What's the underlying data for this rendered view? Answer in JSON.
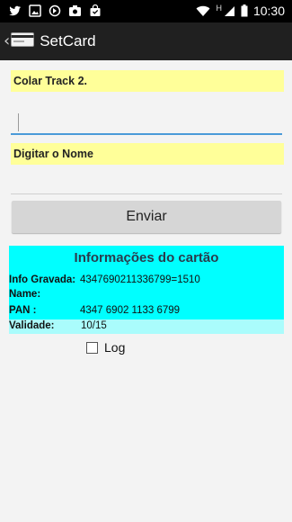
{
  "status_bar": {
    "time": "10:30",
    "left_icons": [
      "twitter-icon",
      "image-icon",
      "sync-icon",
      "camera-icon",
      "shopping-bag-icon"
    ],
    "right_icons": [
      "wifi-icon",
      "signal-icon",
      "battery-icon"
    ],
    "network_type": "H"
  },
  "action_bar": {
    "title": "SetCard"
  },
  "form": {
    "track_label": "Colar Track 2.",
    "track_value": "",
    "name_label": "Digitar o Nome",
    "name_value": "",
    "send_label": "Enviar"
  },
  "card_info": {
    "title": "Informações do cartão",
    "rows": [
      {
        "key": "Info Gravada:",
        "value": "4347690211336799=1510"
      },
      {
        "key": "Name:",
        "value": ""
      },
      {
        "key": "PAN :",
        "value": "4347 6902 1133 6799"
      },
      {
        "key": "Validade:",
        "value": "10/15"
      }
    ]
  },
  "log": {
    "label": "Log",
    "checked": false
  }
}
